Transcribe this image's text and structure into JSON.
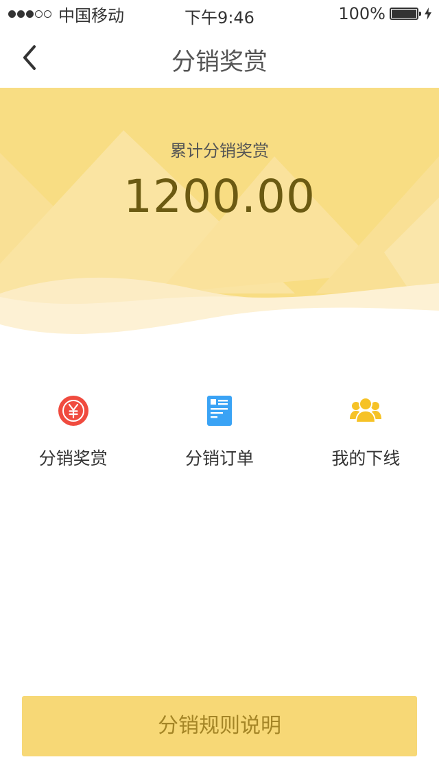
{
  "status_bar": {
    "carrier": "中国移动",
    "time": "下午9:46",
    "battery": "100%",
    "battery_level": 1.0,
    "signal_strength": 3,
    "signal_max": 5
  },
  "nav": {
    "title": "分销奖赏",
    "back_icon": "chevron-left-icon"
  },
  "banner": {
    "label": "累计分销奖赏",
    "amount": "1200.00"
  },
  "menu": {
    "items": [
      {
        "label": "分销奖赏",
        "icon": "yuan-coin-icon",
        "color": "#f04b3f"
      },
      {
        "label": "分销订单",
        "icon": "order-document-icon",
        "color": "#3aa3f5"
      },
      {
        "label": "我的下线",
        "icon": "team-users-icon",
        "color": "#f6c226"
      }
    ]
  },
  "footer": {
    "rules_button": "分销规则说明"
  },
  "colors": {
    "banner_base": "#f8dd83",
    "button_bg": "#f7d876",
    "button_text": "#a48526",
    "amount_text": "#6b5a12"
  }
}
